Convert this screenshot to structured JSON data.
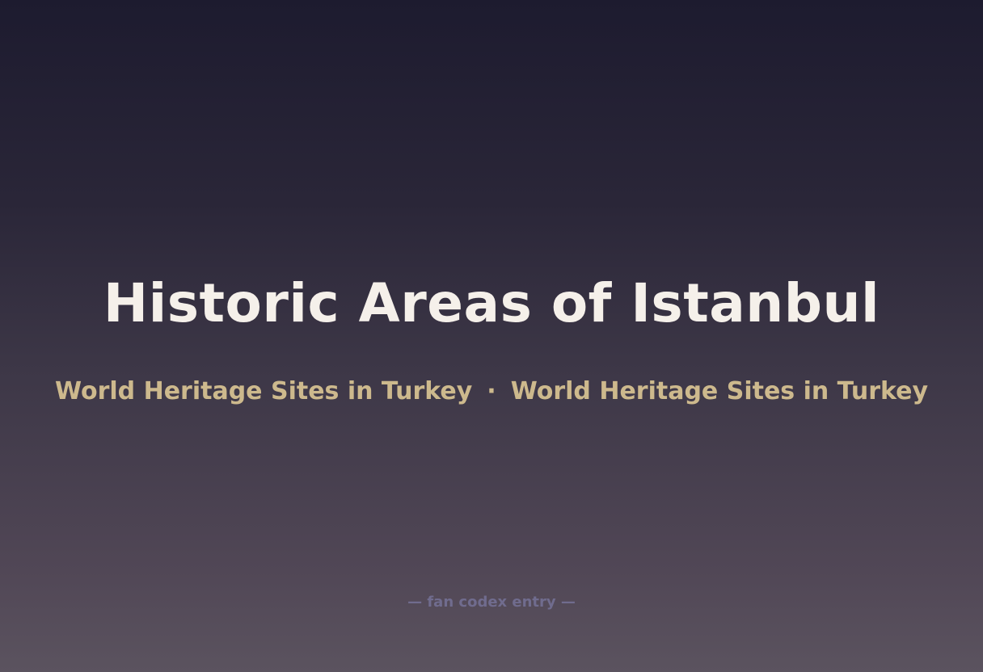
{
  "card": {
    "title": "Historic Areas of Istanbul",
    "categories": [
      "World Heritage Sites in Turkey",
      "World Heritage Sites in Turkey"
    ],
    "separator": "·",
    "footer": "— fan codex entry —"
  },
  "colors": {
    "background_top": "#1d1b2f",
    "background_bottom": "#5b535f",
    "title": "#f5f0ea",
    "subtitle": "#cdb98d",
    "footer": "#706c8e"
  }
}
